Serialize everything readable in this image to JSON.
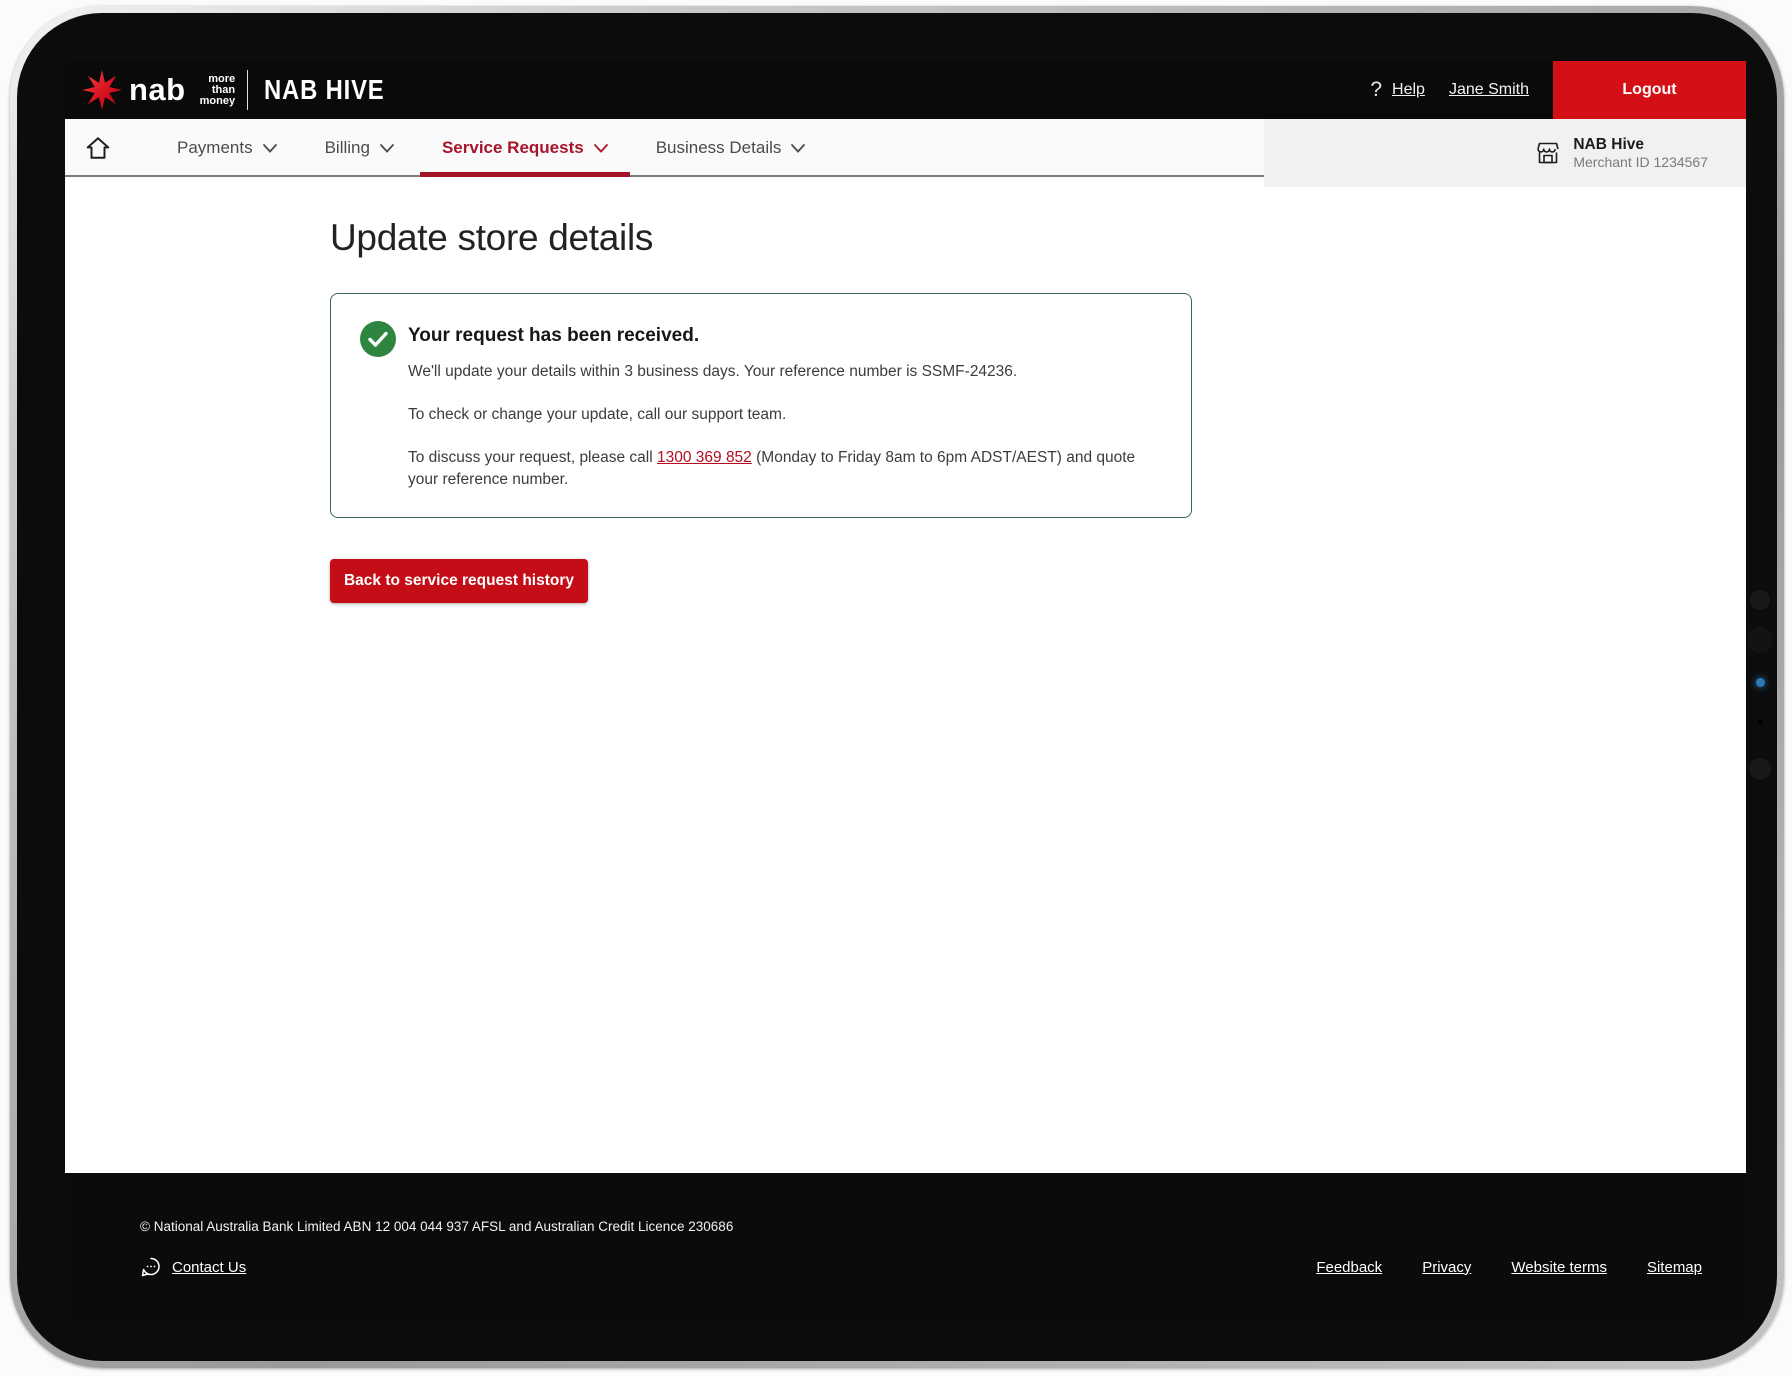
{
  "header": {
    "brand": {
      "nab": "nab",
      "tagline": [
        "more",
        "than",
        "money"
      ],
      "app_name": "NAB HIVE"
    },
    "help_glyph": "?",
    "help_label": "Help",
    "user_name": "Jane Smith",
    "logout_label": "Logout"
  },
  "nav": {
    "items": [
      {
        "label": "Payments"
      },
      {
        "label": "Billing"
      },
      {
        "label": "Service Requests"
      },
      {
        "label": "Business Details"
      }
    ],
    "active_item": "Service Requests",
    "merchant": {
      "name": "NAB Hive",
      "id": "Merchant ID 1234567"
    }
  },
  "main": {
    "title": "Update store details",
    "alert": {
      "heading": "Your request has been received.",
      "line1": "We'll update your details within 3 business days. Your reference number is SSMF-24236.",
      "line2": "To check or change your update, call our support team.",
      "line3_prefix": "To discuss your request, please call ",
      "phone": "1300 369 852",
      "line3_suffix": " (Monday to Friday 8am to 6pm ADST/AEST) and quote your reference number.",
      "reference_number": "SSMF-24236"
    },
    "back_button": "Back to service request history"
  },
  "footer": {
    "copyright": "© National Australia Bank Limited ABN 12 004 044 937 AFSL and Australian Credit Licence 230686",
    "contact_label": "Contact Us",
    "links": [
      {
        "label": "Feedback"
      },
      {
        "label": "Privacy"
      },
      {
        "label": "Website terms"
      },
      {
        "label": "Sitemap"
      }
    ]
  },
  "icons": {
    "help": "question-mark",
    "home": "house-outline",
    "nav_chevron": "chevron-down",
    "merchant": "storefront",
    "alert": "check-circle",
    "contact": "speech-bubble",
    "brand": "nab-eight-point-star"
  },
  "colors": {
    "brand_star_red": "#d9121f",
    "logout_red": "#d50f16",
    "button_red": "#c40d17",
    "active_nav_red": "#a8152a",
    "nav_underline_red": "#a31526",
    "link_red": "#b30d1f",
    "success_green": "#2e8540",
    "alert_border_green": "#39694a",
    "header_black": "#0a0a0a",
    "footer_black": "#0b0b0b"
  }
}
